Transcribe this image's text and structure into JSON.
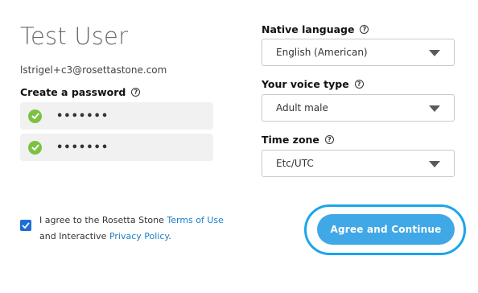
{
  "user": {
    "name": "Test User",
    "email": "lstrigel+c3@rosettastone.com"
  },
  "password": {
    "label": "Create a password",
    "field1_value": "•••••••",
    "field2_value": "•••••••"
  },
  "native_language": {
    "label": "Native language",
    "value": "English (American)"
  },
  "voice_type": {
    "label": "Your voice type",
    "value": "Adult male"
  },
  "time_zone": {
    "label": "Time zone",
    "value": "Etc/UTC"
  },
  "agreement": {
    "checked": true,
    "text_1": "I agree to the Rosetta Stone ",
    "terms_link": "Terms of Use",
    "text_2": " and Interactive ",
    "privacy_link": "Privacy Policy",
    "text_3": "."
  },
  "cta": {
    "label": "Agree and Continue"
  },
  "colors": {
    "accent": "#40a8e6",
    "focus_ring": "#1aa5ec",
    "valid_green": "#7cc242",
    "link": "#1a7ec8",
    "checkbox": "#1f6ed6"
  },
  "icons": {
    "help": "help-circle-icon",
    "valid": "check-circle-icon",
    "dropdown": "chevron-down-icon",
    "checkbox": "checkmark-icon"
  }
}
